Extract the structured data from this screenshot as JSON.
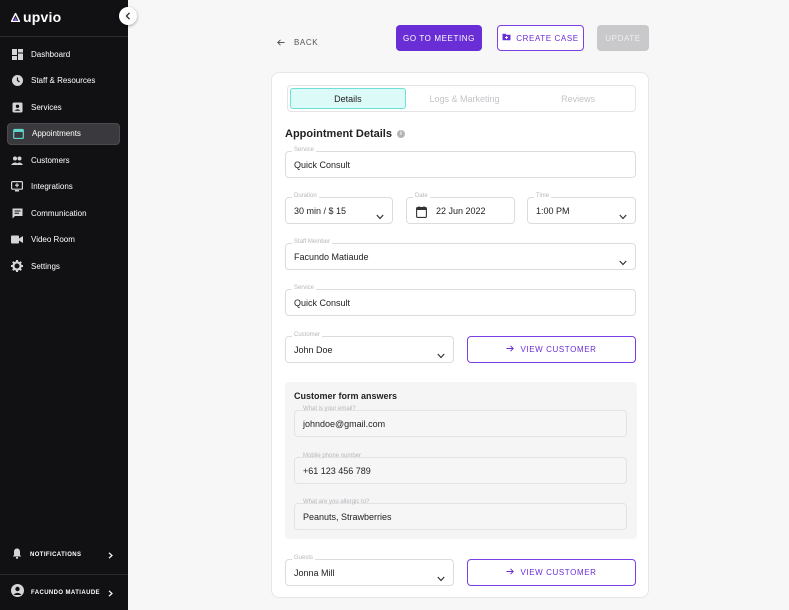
{
  "brand": {
    "name": "upvio",
    "accent": "#6a2ed6"
  },
  "sidebar": {
    "items": [
      {
        "label": "Dashboard",
        "icon": "dashboard-icon",
        "active": false
      },
      {
        "label": "Staff & Resources",
        "icon": "clock-icon",
        "active": false
      },
      {
        "label": "Services",
        "icon": "services-icon",
        "active": false
      },
      {
        "label": "Appointments",
        "icon": "calendar-icon",
        "active": true
      },
      {
        "label": "Customers",
        "icon": "people-icon",
        "active": false
      },
      {
        "label": "Integrations",
        "icon": "integrations-icon",
        "active": false
      },
      {
        "label": "Communication",
        "icon": "chat-icon",
        "active": false
      },
      {
        "label": "Video Room",
        "icon": "video-icon",
        "active": false
      },
      {
        "label": "Settings",
        "icon": "gear-icon",
        "active": false
      }
    ],
    "notifications_label": "NOTIFICATIONS",
    "user_name": "FACUNDO MATIAUDE"
  },
  "topbar": {
    "back_label": "BACK",
    "go_to_meeting": "GO TO MEETING",
    "create_case": "CREATE CASE",
    "update": "UPDATE"
  },
  "tabs": [
    {
      "label": "Details",
      "active": true
    },
    {
      "label": "Logs & Marketing",
      "active": false
    },
    {
      "label": "Reviews",
      "active": false
    }
  ],
  "details": {
    "title": "Appointment Details",
    "service_label": "Service",
    "service_value": "Quick Consult",
    "duration_label": "Duration",
    "duration_value": "30 min / $ 15",
    "date_label": "Date",
    "date_value": "22 Jun 2022",
    "time_label": "Time",
    "time_value": "1:00 PM",
    "staff_label": "Staff Member",
    "staff_value": "Facundo Matiaude",
    "service2_label": "Service",
    "service2_value": "Quick Consult",
    "customer_label": "Customer",
    "customer_value": "John Doe",
    "view_customer": "VIEW CUSTOMER",
    "form_title": "Customer form answers",
    "email_label": "What is your email?",
    "email_value": "johndoe@gmail.com",
    "phone_label": "Mobile phone number",
    "phone_value": "+61 123 456 789",
    "allergy_label": "What are you allergic to?",
    "allergy_value": "Peanuts, Strawberries",
    "guests_label": "Guests",
    "guests_value": "Jonna Mill",
    "view_customer_2": "VIEW CUSTOMER"
  }
}
